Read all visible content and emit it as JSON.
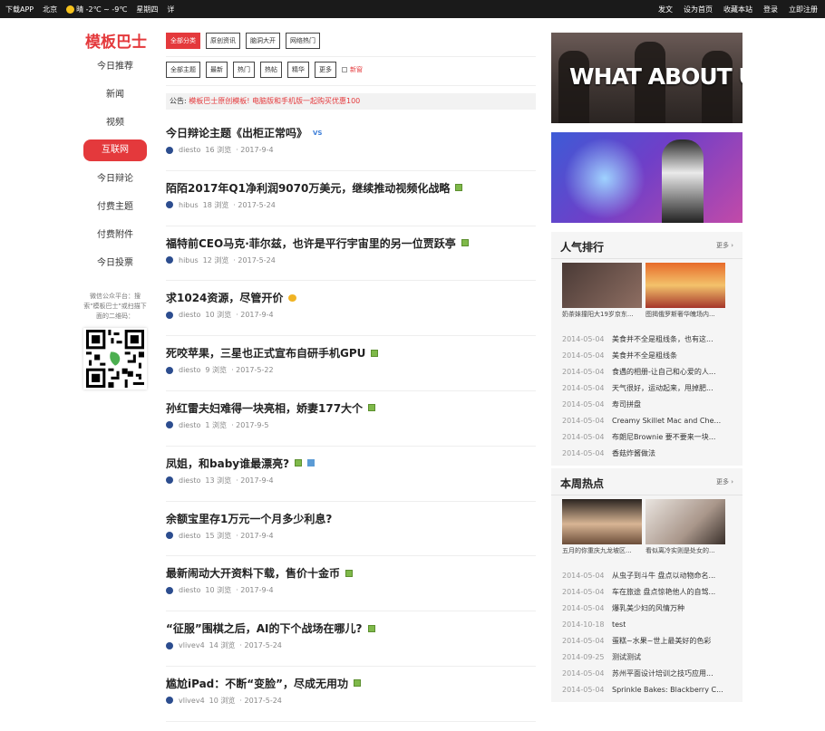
{
  "topbar": {
    "left": [
      "下载APP",
      "北京",
      "晴 -2℃ ~ -9℃",
      "星期四",
      "详"
    ],
    "right": [
      "发文",
      "设为首页",
      "收藏本站",
      "登录",
      "立即注册"
    ]
  },
  "logo": "模板巴士",
  "nav": [
    "今日推荐",
    "新闻",
    "视频",
    "互联网",
    "今日辩论",
    "付费主题",
    "付费附件",
    "今日投票"
  ],
  "wechat_text": "微信公众平台：搜索\"模板巴士\"或扫描下面的二维码：",
  "filters_row1": [
    "全部分类",
    "原创资讯",
    "脑洞大开",
    "网络热门"
  ],
  "filters_row2": [
    "全部主题",
    "最新",
    "热门",
    "热帖",
    "精华",
    "更多"
  ],
  "new_label": "新窗",
  "notice": {
    "label": "公告:",
    "text": "模板巴士原创模板! 电脑版和手机版一起购买优惠100"
  },
  "threads": [
    {
      "title": "今日辩论主题《出柜正常吗》",
      "author": "diesto",
      "views": "16 浏览",
      "date": "· 2017-9-4",
      "badge": "vs"
    },
    {
      "title": "陌陌2017年Q1净利润9070万美元，继续推动视频化战略",
      "author": "hibus",
      "views": "18 浏览",
      "date": "· 2017-5-24",
      "badge": "img"
    },
    {
      "title": "福特前CEO马克·菲尔兹，也许是平行宇宙里的另一位贾跃亭",
      "author": "hibus",
      "views": "12 浏览",
      "date": "· 2017-5-24",
      "badge": "img"
    },
    {
      "title": "求1024资源，尽管开价",
      "author": "diesto",
      "views": "10 浏览",
      "date": "· 2017-9-4",
      "badge": "reward"
    },
    {
      "title": "死咬苹果，三星也正式宣布自研手机GPU",
      "author": "diesto",
      "views": "9 浏览",
      "date": "· 2017-5-22",
      "badge": "img"
    },
    {
      "title": "孙红雷夫妇难得一块亮相，娇妻177大个",
      "author": "diesto",
      "views": "1 浏览",
      "date": "· 2017-9-5",
      "badge": "img"
    },
    {
      "title": "凤姐，和baby谁最漂亮?",
      "author": "diesto",
      "views": "13 浏览",
      "date": "· 2017-9-4",
      "badge": "img-poll"
    },
    {
      "title": "余额宝里存1万元一个月多少利息?",
      "author": "diesto",
      "views": "15 浏览",
      "date": "· 2017-9-4",
      "badge": ""
    },
    {
      "title": "最新闹动大开资料下载，售价十金币",
      "author": "diesto",
      "views": "10 浏览",
      "date": "· 2017-9-4",
      "badge": "img"
    },
    {
      "title": "“征服”围棋之后，AI的下个战场在哪儿?",
      "author": "vlivev4",
      "views": "14 浏览",
      "date": "· 2017-5-24",
      "badge": "img"
    },
    {
      "title": "尴尬iPad：不断“变脸”，尽成无用功",
      "author": "vlivev4",
      "views": "10 浏览",
      "date": "· 2017-5-24",
      "badge": "img"
    }
  ],
  "banner1_text": "WHAT ABOUT US",
  "popular": {
    "title": "人气排行",
    "more": "更多 ›",
    "pics": [
      "奶茶妹撞阳大19岁京东...",
      "图揭俄罗斯奢华魄场内..."
    ],
    "items": [
      {
        "date": "2014-05-04",
        "title": "美食并不全是粗线条，也有这..."
      },
      {
        "date": "2014-05-04",
        "title": "美食并不全是粗线条"
      },
      {
        "date": "2014-05-04",
        "title": "食遇的相册-让自己和心爱的人..."
      },
      {
        "date": "2014-05-04",
        "title": "天气很好，运动起来，甩掉肥..."
      },
      {
        "date": "2014-05-04",
        "title": "寿司拼盘"
      },
      {
        "date": "2014-05-04",
        "title": "Creamy Skillet Mac and Che..."
      },
      {
        "date": "2014-05-04",
        "title": "布朗尼Brownie 要不要来一块..."
      },
      {
        "date": "2014-05-04",
        "title": "香菇炸酱做法"
      }
    ]
  },
  "weekly": {
    "title": "本周热点",
    "more": "更多 ›",
    "pics": [
      "五月的你重庆九龙坡区...",
      "看似离冷实则是处女的..."
    ],
    "items": [
      {
        "date": "2014-05-04",
        "title": "从虫子到斗牛 盘点以动物命名..."
      },
      {
        "date": "2014-05-04",
        "title": "车在旅途 盘点惊艳他人的自驾..."
      },
      {
        "date": "2014-05-04",
        "title": "爆乳美少妇的风情万种"
      },
      {
        "date": "2014-10-18",
        "title": "test"
      },
      {
        "date": "2014-05-04",
        "title": "蛋糕~水果~世上最美好的色彩"
      },
      {
        "date": "2014-09-25",
        "title": "测试测试"
      },
      {
        "date": "2014-05-04",
        "title": "苏州平面设计培训之技巧应用..."
      },
      {
        "date": "2014-05-04",
        "title": "Sprinkle Bakes: Blackberry C..."
      }
    ]
  },
  "colors": {
    "accent": "#e4393c",
    "topbar": "#1a1a1a"
  }
}
